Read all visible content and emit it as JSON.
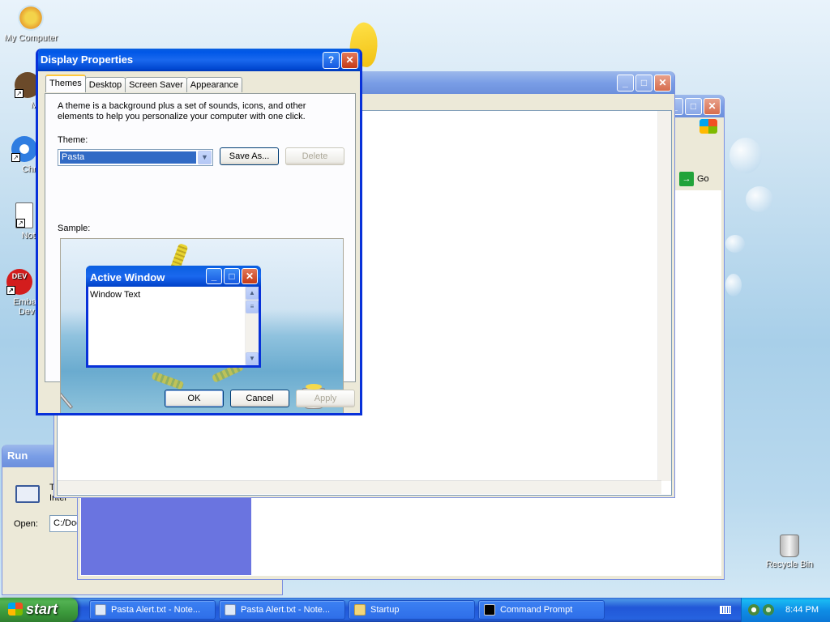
{
  "desktop": {
    "icons": [
      {
        "label": "My Computer"
      },
      {
        "label": "MyPa"
      },
      {
        "label": "Chrom"
      },
      {
        "label": "Notepa"
      },
      {
        "label": "Embarc Dev-C"
      }
    ],
    "recycle_bin": "Recycle Bin"
  },
  "display_properties": {
    "title": "Display Properties",
    "tabs": [
      "Themes",
      "Desktop",
      "Screen Saver",
      "Appearance"
    ],
    "description": "A theme is a background plus a set of sounds, icons, and other elements to help you personalize your computer with one click.",
    "theme_label": "Theme:",
    "theme_value": "Pasta",
    "save_as": "Save As...",
    "delete": "Delete",
    "sample_label": "Sample:",
    "sample_window_title": "Active Window",
    "sample_window_text": "Window Text",
    "ok": "OK",
    "cancel": "Cancel",
    "apply": "Apply"
  },
  "background_window": {
    "go": "Go"
  },
  "run_dialog": {
    "title": "Run",
    "text_fragment": "T",
    "text_fragment2": "Inter",
    "open_label": "Open:",
    "open_value": "C:/Doc"
  },
  "taskbar": {
    "start": "start",
    "items": [
      "Pasta Alert.txt - Note...",
      "Pasta Alert.txt - Note...",
      "Startup",
      "Command Prompt"
    ],
    "clock": "8:44 PM"
  }
}
